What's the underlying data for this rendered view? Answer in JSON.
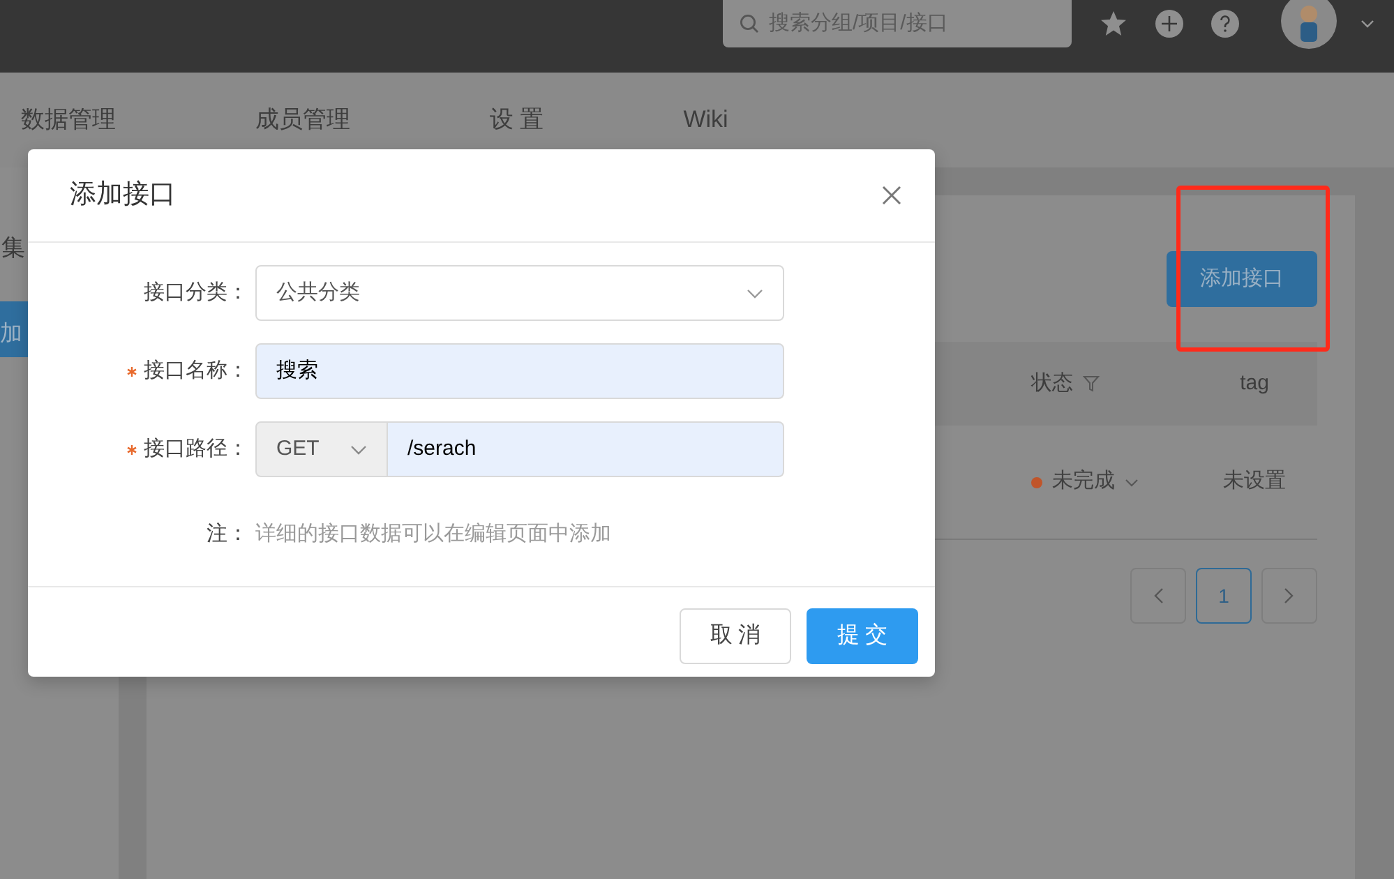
{
  "topbar": {
    "search": {
      "placeholder": "搜索分组/项目/接口"
    }
  },
  "nav": {
    "tabs": [
      {
        "label": "数据管理",
        "selected": false
      },
      {
        "label": "成员管理",
        "selected": false
      },
      {
        "label": "设 置",
        "selected": false
      },
      {
        "label": "Wiki",
        "selected": false
      }
    ]
  },
  "sidebar": {
    "title": "集",
    "button": "加"
  },
  "main": {
    "add_button": "添加接口",
    "columns": [
      {
        "label": "状态",
        "filter": true
      },
      {
        "label": "tag",
        "filter": false
      }
    ],
    "rows": [
      {
        "status": "未完成",
        "color": "#c0552a",
        "tag": "未设置"
      }
    ],
    "pagination": {
      "pages": [
        {
          "label": "1",
          "selected": true
        }
      ]
    }
  },
  "modal": {
    "title": "添加接口",
    "fields": [
      {
        "kind": "select",
        "label": "接口分类：",
        "required": false,
        "value": "公共分类"
      },
      {
        "kind": "input",
        "label": "接口名称：",
        "required": true,
        "value": "搜索"
      },
      {
        "kind": "method-input",
        "label": "接口路径：",
        "required": true,
        "method": "GET",
        "value": "/serach"
      }
    ],
    "note": {
      "label": "注：",
      "text": "详细的接口数据可以在编辑页面中添加"
    },
    "buttons": [
      {
        "label": "取 消",
        "kind": "default"
      },
      {
        "label": "提 交",
        "kind": "primary"
      }
    ]
  }
}
